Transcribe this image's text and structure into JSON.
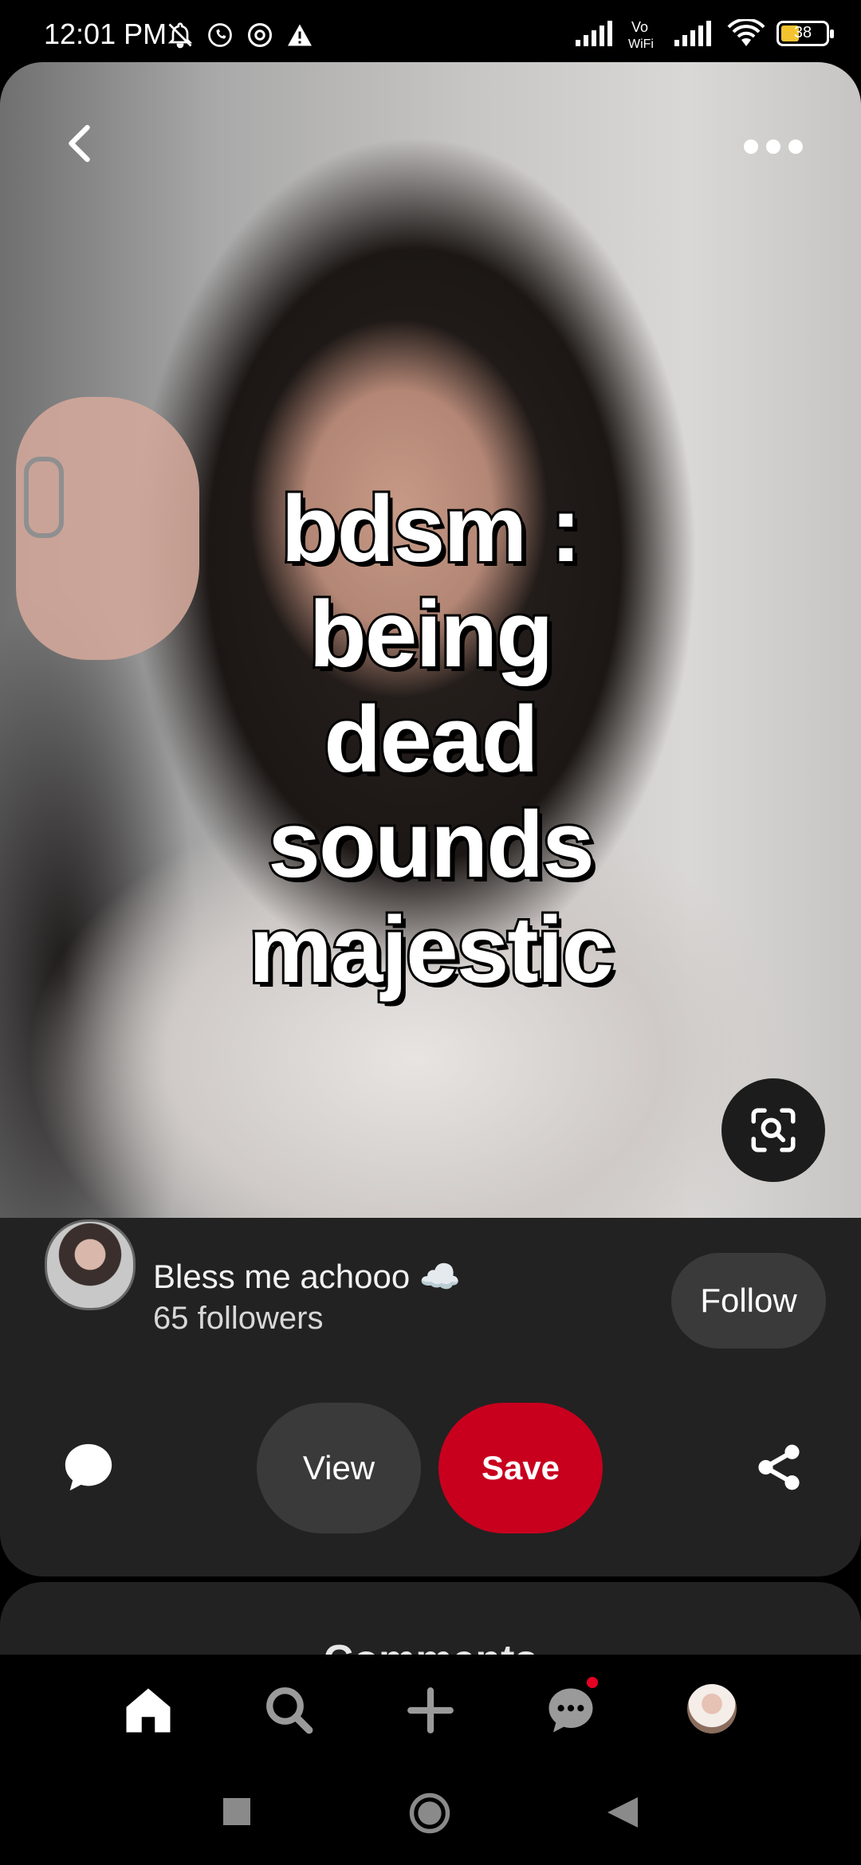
{
  "status_bar": {
    "time": "12:01 PM",
    "battery": "38",
    "left_icons": [
      "bell-off-icon",
      "whatsapp-icon",
      "chrome-icon",
      "warning-icon"
    ],
    "right_icons": [
      "signal-icon",
      "vowifi-icon",
      "signal-icon",
      "wifi-icon",
      "battery-icon"
    ]
  },
  "pin": {
    "overlay_text": "bdsm :\nbeing\ndead\nsounds\nmajestic"
  },
  "creator": {
    "name": "Bless me achooo ☁️",
    "followers": "65 followers",
    "follow_label": "Follow"
  },
  "actions": {
    "view_label": "View",
    "save_label": "Save"
  },
  "comments": {
    "title": "Comments"
  },
  "colors": {
    "save": "#c8001e",
    "notification": "#e60023"
  }
}
